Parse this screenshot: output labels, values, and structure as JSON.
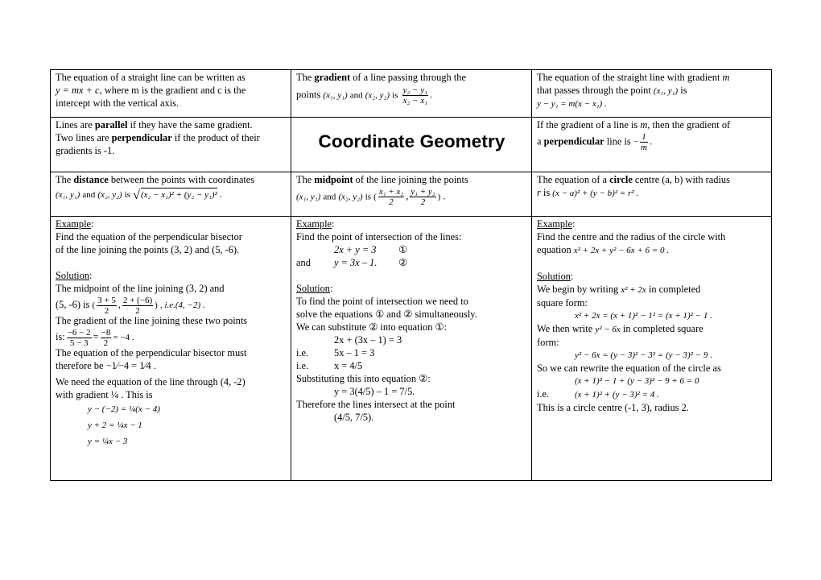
{
  "document": {
    "title": "Coordinate Geometry",
    "colors": {
      "text": "#000000",
      "border": "#000000",
      "background": "#ffffff"
    },
    "cells": {
      "straight_line": {
        "line1": "The equation of a straight line can be written as",
        "eq": "y = mx + c",
        "line2_rest": ", where m is the gradient and c is the",
        "line3": "intercept with the vertical axis."
      },
      "gradient": {
        "pre": "The ",
        "bold": "gradient",
        "post": " of a line passing through the",
        "points": "points",
        "p1": "(x₁, y₁)",
        "and": "and",
        "p2": "(x₂, y₂)",
        "is": "is",
        "num": "y₂ − y₁",
        "den": "x₂ − x₁",
        "end": "."
      },
      "point_gradient": {
        "line1": "The equation of the straight line with gradient ",
        "m": "m",
        "line2": "that passes through the point",
        "p1": "(x₁, y₁)",
        "is": "is",
        "eq": "y − y₁ = m(x − x₁) ."
      },
      "parallel": {
        "pre": "Lines are ",
        "bold1": "parallel",
        "post1": " if they have the same gradient.",
        "pre2": "Two lines are ",
        "bold2": "perpendicular",
        "post2": " if the product of their gradients is -1."
      },
      "perpendicular_gradient": {
        "line1_pre": "If the gradient of a line is ",
        "m": "m",
        "line1_post": ", then the gradient of",
        "pre": "a ",
        "bold": "perpendicular",
        "post": " line is",
        "minus": "−",
        "num": "1",
        "den": "m",
        "end": "."
      },
      "distance": {
        "pre": "The ",
        "bold": "distance",
        "post": " between the points with coordinates",
        "p1": "(x₁, y₁)",
        "and": "and",
        "p2": "(x₂, y₂)",
        "is": "is",
        "radicand": "(x₂ − x₁)² + (y₂ − y₁)²",
        "end": "."
      },
      "midpoint": {
        "pre": "The ",
        "bold": "midpoint",
        "post": " of the line joining the points",
        "p1": "(x₁, y₁)",
        "and": "and",
        "p2": "(x₂, y₂)",
        "is": "is",
        "num1": "x₁ + x₂",
        "den1": "2",
        "num2": "y₁ + y₂",
        "den2": "2",
        "end": "."
      },
      "circle": {
        "pre": "The equation of a ",
        "bold": "circle",
        "post": " centre (a, b) with radius",
        "r": "r",
        "is": " is ",
        "eq": "(x − a)² + (y − b)² = r² ."
      }
    },
    "examples": [
      {
        "heading": "Example",
        "question": [
          "Find the equation of the perpendicular bisector",
          "of the line joining the points (3, 2) and (5, -6)."
        ],
        "solution_heading": "Solution",
        "midpoint_intro": "The midpoint of the line joining (3, 2) and",
        "midpoint_pre": "(5, -6) is",
        "mid_num1": "3 + 5",
        "mid_den1": "2",
        "mid_num2": "2 + (−6)",
        "mid_den2": "2",
        "midpoint_result": ", i.e.(4, −2) .",
        "gradient_intro": "The gradient of the line joining these two points",
        "gradient_is": "is:",
        "g_num1": "−6 − 2",
        "g_den1": "5 − 3",
        "g_num2": "−8",
        "g_den2": "2",
        "g_result": "= −4 .",
        "perp_intro": "The equation of the perpendicular bisector must",
        "perp_pre": "therefore be",
        "perp_expr": "−1⁄−4 = 1⁄4 .",
        "need_line": "We need the equation of the line through (4, -2)",
        "with_gradient": "with gradient ¼ .  This is",
        "steps": [
          "y − (−2) = ¼(x − 4)",
          "y + 2 = ¼x − 1",
          "y = ¼x − 3"
        ]
      },
      {
        "heading": "Example",
        "question": "Find the point of intersection of the lines:",
        "eq1": "2x + y = 3",
        "eq1_label": "①",
        "and": "and",
        "eq2": "y = 3x – 1.",
        "eq2_label": "②",
        "solution_heading": "Solution",
        "lines": [
          "To find the point of intersection we need to",
          "solve the equations ① and ② simultaneously.",
          "We can substitute ② into equation ①:"
        ],
        "step1": "2x + (3x – 1) = 3",
        "ie": "i.e.",
        "step2": "5x – 1 = 3",
        "step3": "x = 4/5",
        "subst": "Substituting this into equation ②:",
        "step4": "y = 3(4/5) – 1 = 7/5.",
        "conclusion": "Therefore the lines intersect at the point",
        "point": "(4/5, 7/5)."
      },
      {
        "heading": "Example",
        "question": "Find the centre and the radius of the circle with",
        "eq_pre": "equation",
        "eq": "x² + 2x + y² − 6x + 6 = 0 .",
        "solution_heading": "Solution",
        "begin_pre": "We begin by writing",
        "begin_expr": "x² + 2x",
        "begin_post": "in completed",
        "square_form": "square form:",
        "cs1": "x² + 2x = (x + 1)² − 1² = (x + 1)² − 1 .",
        "then_pre": "We then write",
        "then_expr": "y² − 6x",
        "then_post": "in completed square",
        "form": "form:",
        "cs2": "y² − 6x = (y − 3)² − 3² = (y − 3)² − 9 .",
        "rewrite": "So we can rewrite the equation of the circle as",
        "rw1": "(x + 1)² − 1 + (y − 3)² − 9 + 6 = 0",
        "ie": "i.e.",
        "rw2": "(x + 1)² + (y − 3)² = 4 .",
        "answer": "This is a circle centre (-1, 3), radius 2."
      }
    ]
  }
}
